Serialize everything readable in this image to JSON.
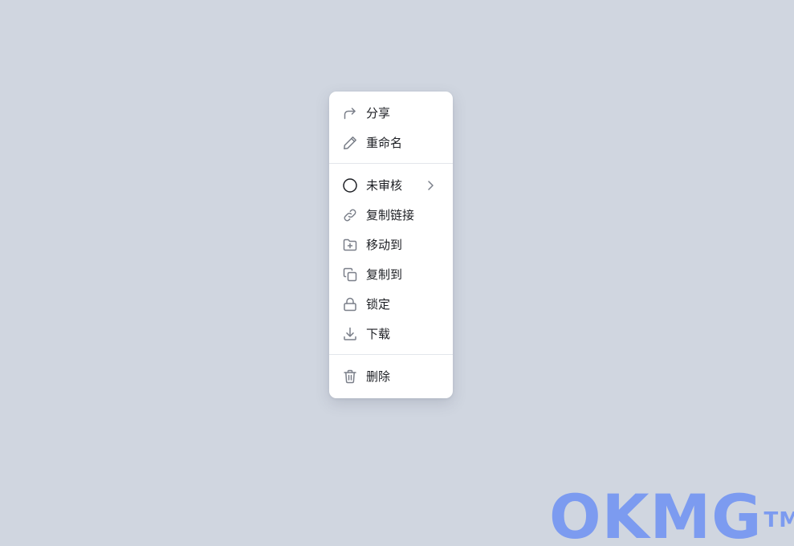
{
  "menu": {
    "items": [
      {
        "icon": "share-forward-icon",
        "label": "分享"
      },
      {
        "icon": "pencil-icon",
        "label": "重命名"
      },
      {
        "icon": "circle-status-icon",
        "label": "未审核"
      },
      {
        "icon": "link-icon",
        "label": "复制链接"
      },
      {
        "icon": "folder-plus-icon",
        "label": "移动到"
      },
      {
        "icon": "copy-icon",
        "label": "复制到"
      },
      {
        "icon": "lock-icon",
        "label": "锁定"
      },
      {
        "icon": "download-icon",
        "label": "下载"
      },
      {
        "icon": "trash-icon",
        "label": "删除"
      }
    ]
  },
  "watermark": {
    "text": "OKMG",
    "mark": "TM"
  },
  "colors": {
    "background": "#d0d6e0",
    "menu_bg": "#ffffff",
    "icon": "#7a7f89",
    "text": "#1d1f24",
    "divider": "#e3e6eb",
    "watermark": "#7c9bf0"
  }
}
